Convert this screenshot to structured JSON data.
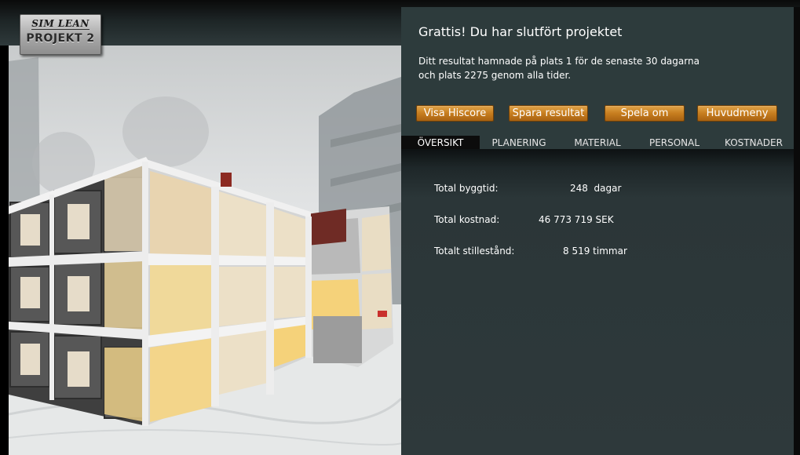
{
  "logo": {
    "brand": "Sim Lean",
    "project": "PROJEKT 2"
  },
  "result": {
    "title": "Grattis! Du har slutfört projektet",
    "message_line1": "Ditt resultat hamnade på plats 1 för de senaste 30 dagarna",
    "message_line2": "och plats 2275 genom alla tider."
  },
  "buttons": {
    "hiscore": "Visa Hiscore",
    "save": "Spara resultat",
    "replay": "Spela om",
    "menu": "Huvudmeny"
  },
  "tabs": [
    {
      "label": "ÖVERSIKT",
      "active": true
    },
    {
      "label": "PLANERING",
      "active": false
    },
    {
      "label": "MATERIAL",
      "active": false
    },
    {
      "label": "PERSONAL",
      "active": false
    },
    {
      "label": "KOSTNADER",
      "active": false
    }
  ],
  "stats": {
    "build_time_label": "Total byggtid:",
    "build_time_value": "248",
    "build_time_unit": "dagar",
    "cost_label": "Total kostnad:",
    "cost_value": "46 773 719 SEK",
    "downtime_label": "Totalt stillestånd:",
    "downtime_value": "8 519 timmar"
  },
  "colors": {
    "panel_bg": "#2d3b3c",
    "button_orange": "#c77e1f",
    "active_tab": "#0c0c0c"
  }
}
